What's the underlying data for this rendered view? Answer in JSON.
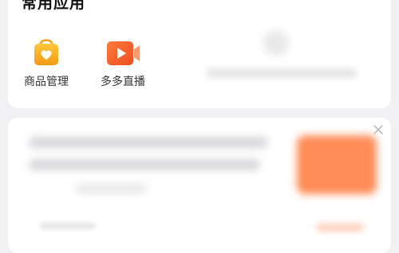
{
  "section": {
    "title": "常用应用"
  },
  "apps": [
    {
      "label": "商品管理",
      "icon": "shopping-bag-icon",
      "color": "#f7a21d"
    },
    {
      "label": "多多直播",
      "icon": "live-video-icon",
      "color": "#f2602c"
    }
  ],
  "colors": {
    "background": "#f1f1f3",
    "card": "#ffffff",
    "accent": "#ff8c57"
  }
}
